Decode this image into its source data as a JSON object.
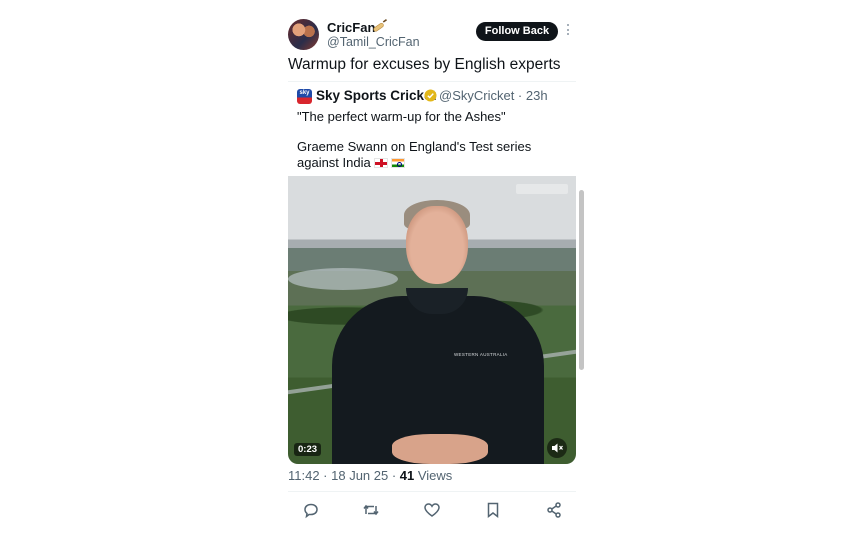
{
  "author": {
    "name": "CricFan",
    "name_emoji": "cricket-bat",
    "handle": "@Tamil_CricFan",
    "follow_label": "Follow Back"
  },
  "tweet": {
    "text": "Warmup for excuses by English experts",
    "meta_prefix": "11:42 · 18 Jun 25 · ",
    "views_count": "41",
    "views_label": " Views"
  },
  "quote": {
    "name": "Sky Sports Cricket",
    "handle_time": "@SkyCricket · 23h",
    "line1": "\"The perfect warm-up for the Ashes\"",
    "line2": "Graeme Swann on England's Test series against India",
    "logo_text": "sky",
    "video": {
      "duration": "0:23",
      "shirt_logo": "WESTERN AUSTRALIA"
    }
  },
  "actions": [
    "reply-icon",
    "retweet-icon",
    "like-icon",
    "bookmark-icon",
    "share-icon"
  ],
  "colors": {
    "text": "#0f1419",
    "secondary": "#536471",
    "follow_bg": "#0f1419",
    "verified": "#e2b719"
  }
}
